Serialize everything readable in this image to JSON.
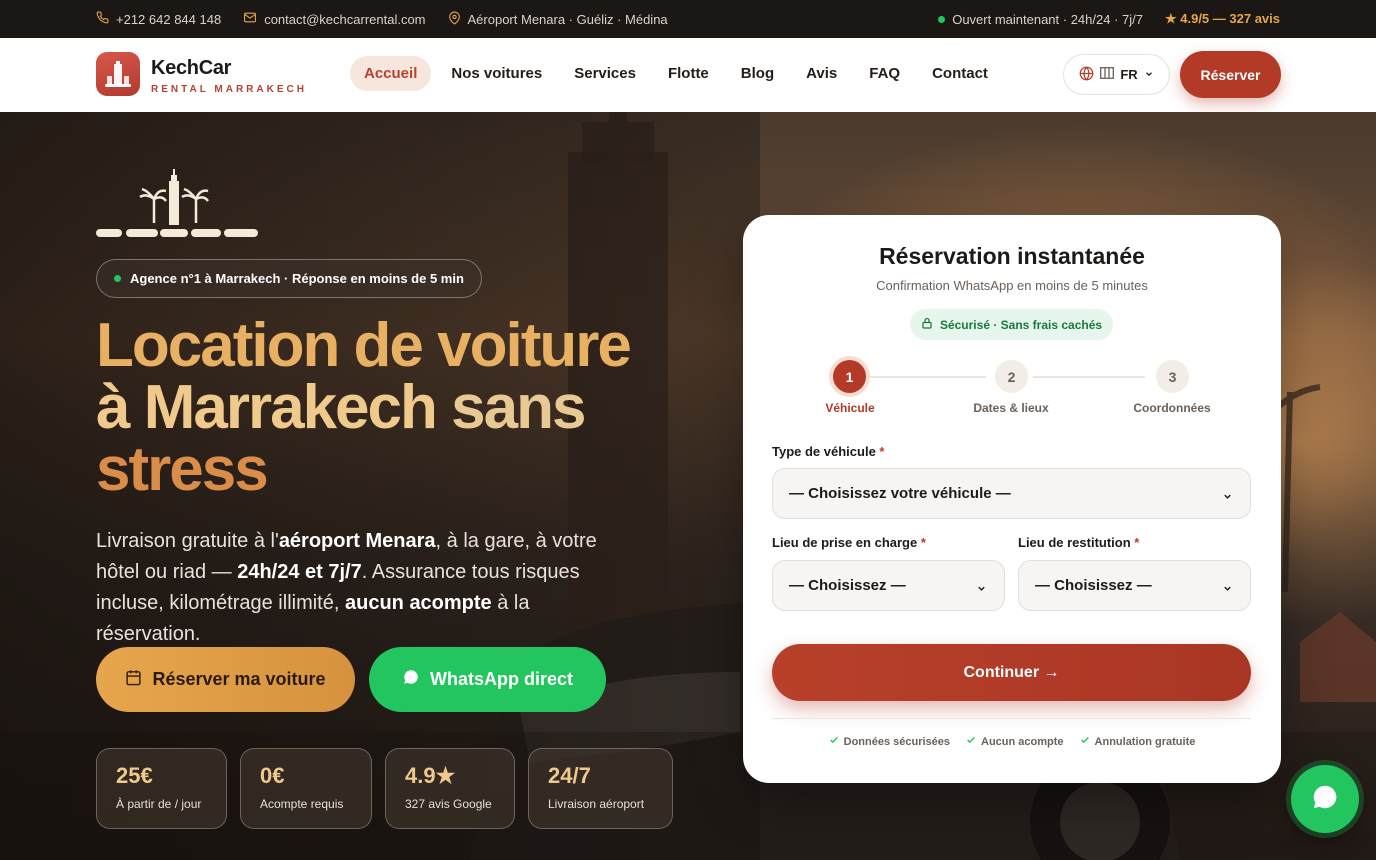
{
  "topbar": {
    "phone": "+212 642 844 148",
    "email": "contact@kechcarrental.com",
    "location": "Aéroport Menara · Guéliz · Médina",
    "open_status": "Ouvert maintenant · 24h/24 · 7j/7",
    "rating": "★ 4.9/5 — 327 avis"
  },
  "brand": {
    "name": "KechCar",
    "tagline": "RENTAL MARRAKECH"
  },
  "nav": {
    "items": [
      {
        "label": "Accueil",
        "active": true
      },
      {
        "label": "Nos voitures"
      },
      {
        "label": "Services"
      },
      {
        "label": "Flotte"
      },
      {
        "label": "Blog"
      },
      {
        "label": "Avis"
      },
      {
        "label": "FAQ"
      },
      {
        "label": "Contact"
      }
    ],
    "language": "FR",
    "reserve_button": "Réserver"
  },
  "hero": {
    "badge": "Agence n°1 à Marrakech · Réponse en moins de 5 min",
    "title_line1": "Location de voiture",
    "title_line2a": "à Marrakech",
    "title_line2b": "sans",
    "title_line3": "stress",
    "lead_1": "Livraison gratuite à l'",
    "lead_2": "aéroport Menara",
    "lead_3": ", à la gare, à votre hôtel ou riad — ",
    "lead_4": "24h/24 et 7j/7",
    "lead_5": ". Assurance tous risques incluse, kilométrage illimité, ",
    "lead_6": "aucun acompte",
    "lead_7": " à la réservation.",
    "primary_button": "Réserver ma voiture",
    "whatsapp_button": "WhatsApp direct",
    "stats": [
      {
        "value": "25€",
        "label": "À partir de / jour"
      },
      {
        "value": "0€",
        "label": "Acompte requis"
      },
      {
        "value": "4.9★",
        "label": "327 avis Google"
      },
      {
        "value": "24/7",
        "label": "Livraison aéroport"
      }
    ]
  },
  "booking": {
    "title": "Réservation instantanée",
    "subtitle": "Confirmation WhatsApp en moins de 5 minutes",
    "secure": "Sécurisé · Sans frais cachés",
    "steps": [
      {
        "number": "1",
        "label": "Véhicule",
        "active": true
      },
      {
        "number": "2",
        "label": "Dates & lieux"
      },
      {
        "number": "3",
        "label": "Coordonnées"
      }
    ],
    "vehicle_label": "Type de véhicule",
    "vehicle_value": "— Choisissez votre véhicule —",
    "pickup_label": "Lieu de prise en charge",
    "pickup_value": "— Choisissez —",
    "return_label": "Lieu de restitution",
    "return_value": "— Choisissez —",
    "required_mark": "*",
    "continue_button": "Continuer →",
    "trust": [
      "Données sécurisées",
      "Aucun acompte",
      "Annulation gratuite"
    ]
  },
  "colors": {
    "accent": "#b23a27",
    "gold": "#e7a64c",
    "whatsapp": "#22c55e"
  }
}
